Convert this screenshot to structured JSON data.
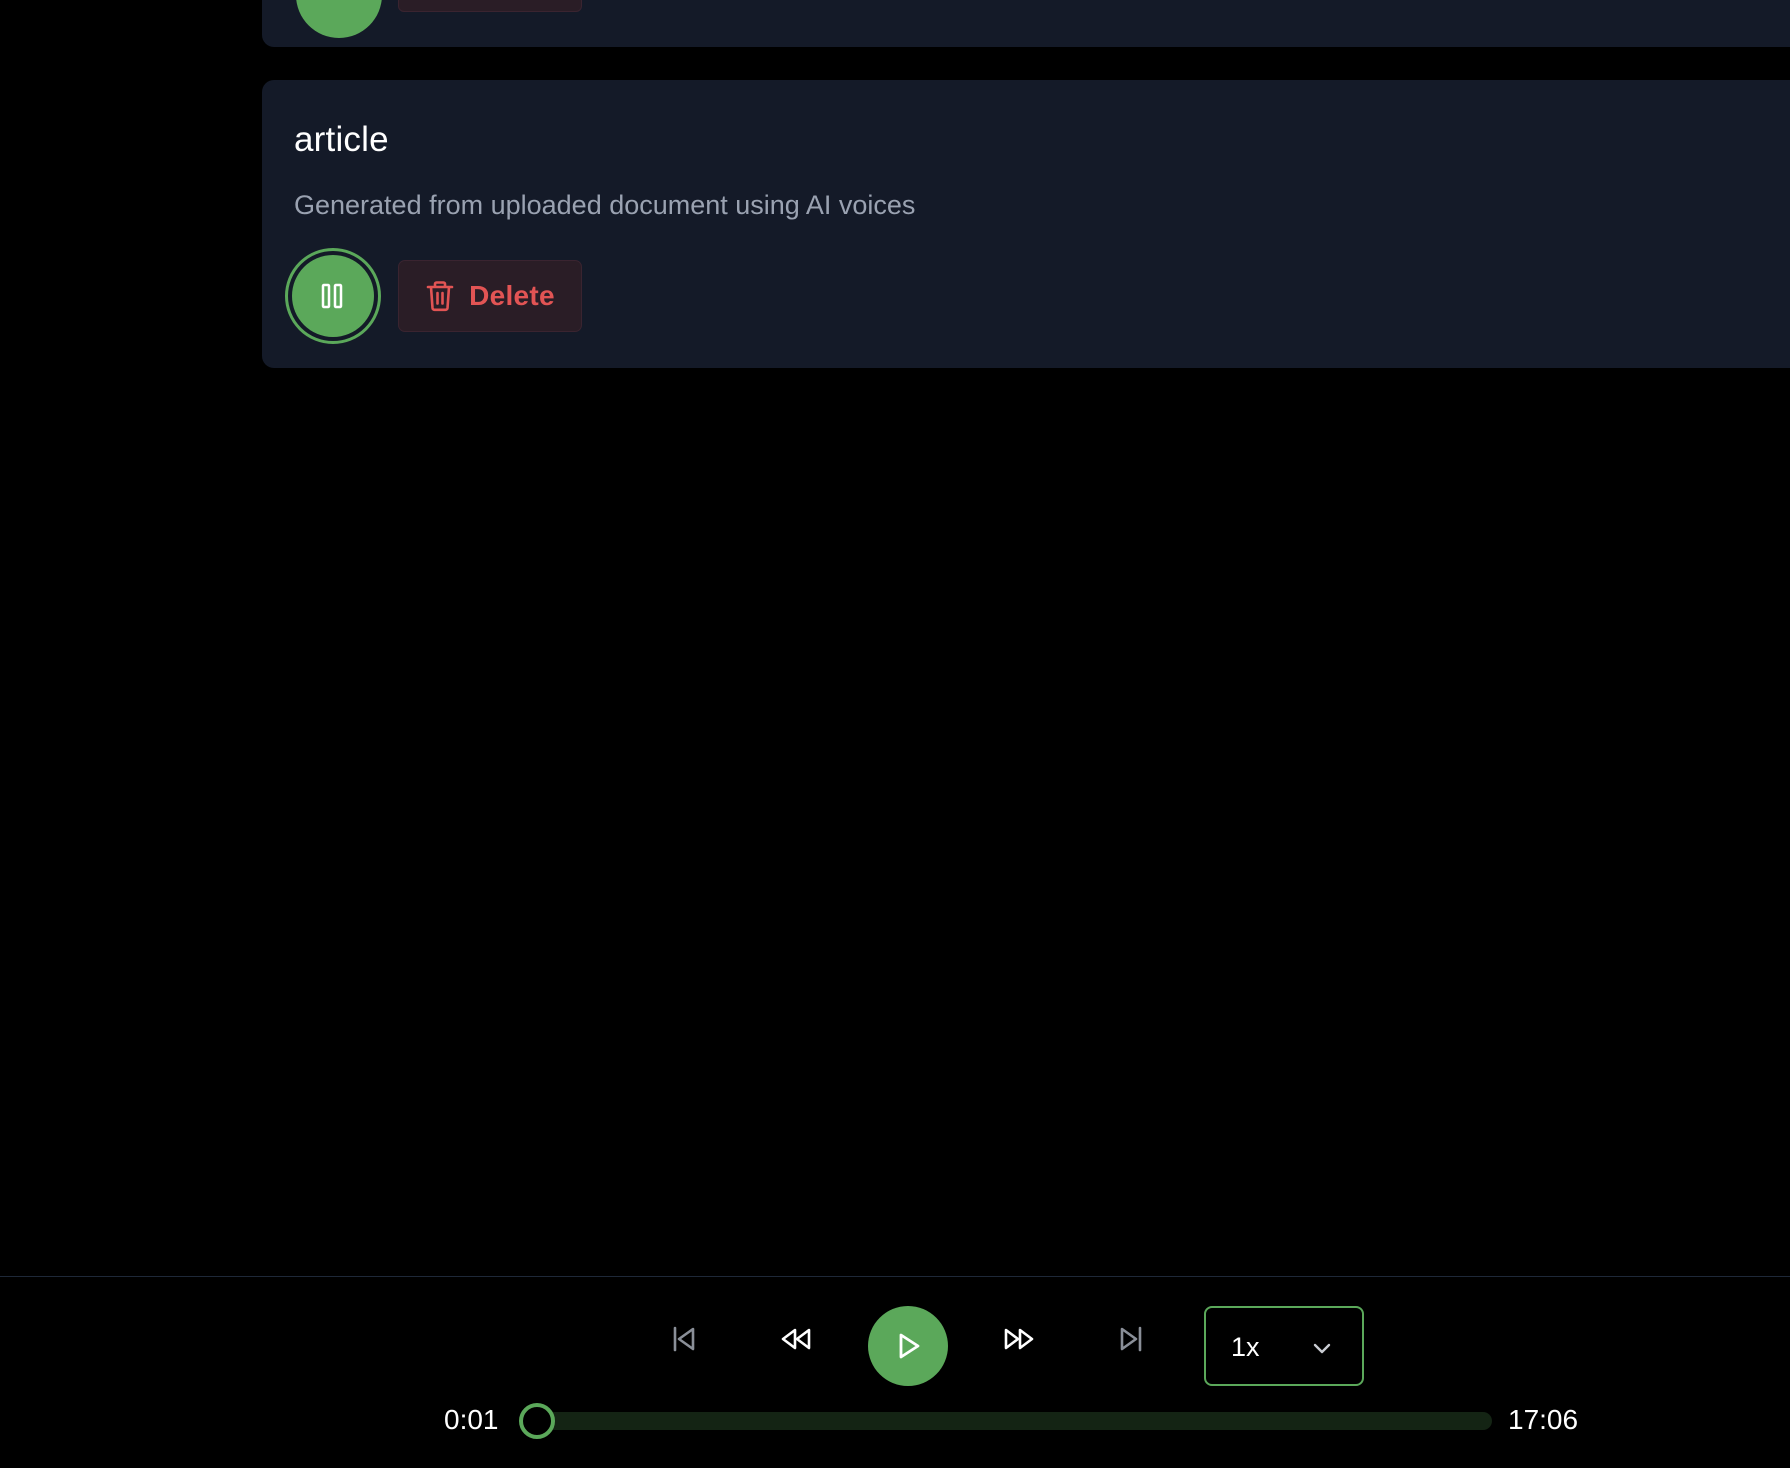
{
  "cards": {
    "article": {
      "title": "article",
      "description": "Generated from uploaded document using AI voices",
      "delete_label": "Delete"
    }
  },
  "player": {
    "current_time": "0:01",
    "total_time": "17:06",
    "speed": "1x",
    "progress_fraction": 0.001
  },
  "colors": {
    "accent": "#5ba85a",
    "danger": "#e25454",
    "card_bg": "#141a28",
    "muted_text": "#9aa2b1"
  },
  "icons": {
    "pause": "pause-icon",
    "trash": "trash-icon",
    "play": "play-icon",
    "skip_back": "skip-back-icon",
    "rewind": "rewind-icon",
    "fast_forward": "fast-forward-icon",
    "skip_forward": "skip-forward-icon",
    "chevron": "chevron-down-icon"
  }
}
